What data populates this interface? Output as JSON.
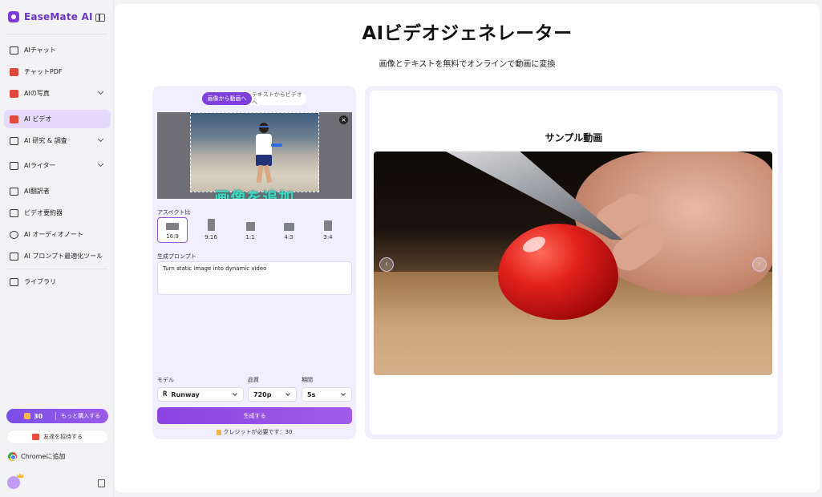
{
  "sidebar": {
    "brand": "EaseMate AI",
    "items": [
      {
        "label": "AIチャット",
        "icon": "chat-icon"
      },
      {
        "label": "チャットPDF",
        "icon": "pdf-icon"
      },
      {
        "label": "AIの写真",
        "icon": "image-icon"
      },
      {
        "label": "AI ビデオ",
        "icon": "video-icon"
      },
      {
        "label": "AI 研究 & 調査",
        "icon": "research-icon"
      },
      {
        "label": "AIライター",
        "icon": "pen-icon"
      },
      {
        "label": "AI翻訳者",
        "icon": "translate-icon"
      },
      {
        "label": "ビデオ要約器",
        "icon": "video-summary-icon"
      },
      {
        "label": "AI オーディオノート",
        "icon": "audio-icon"
      },
      {
        "label": "AI プロンプト最適化ツール",
        "icon": "prompt-icon"
      },
      {
        "label": "ライブラリ",
        "icon": "library-icon"
      }
    ],
    "credits": "30",
    "buy_more": "もっと購入する",
    "invite": "友達を招待する",
    "chrome": "Chromeに追加"
  },
  "main": {
    "title": "AIビデオジェネレーター",
    "subtitle": "画像とテキストを無料でオンラインで動画に変換"
  },
  "generator": {
    "tabs": [
      "画像から動画へ",
      "テキストからビデオへ"
    ],
    "add_image": "画像を追加",
    "aspect_label": "アスペクト比",
    "ratios": [
      "16:9",
      "9:16",
      "1:1",
      "4:3",
      "3:4"
    ],
    "prompt_label": "生成プロンプト",
    "prompt_value": "Turn static image into dynamic video",
    "model_label": "モデル",
    "model_value": "Runway",
    "quality_label": "品質",
    "quality_value": "720p",
    "duration_label": "期間",
    "duration_value": "5s",
    "generate": "生成する",
    "credit_note": "クレジットが必要です：30"
  },
  "sample": {
    "title": "サンプル動画"
  },
  "colors": {
    "accent": "#7e3fdb",
    "panel_bg": "#f1effd"
  }
}
